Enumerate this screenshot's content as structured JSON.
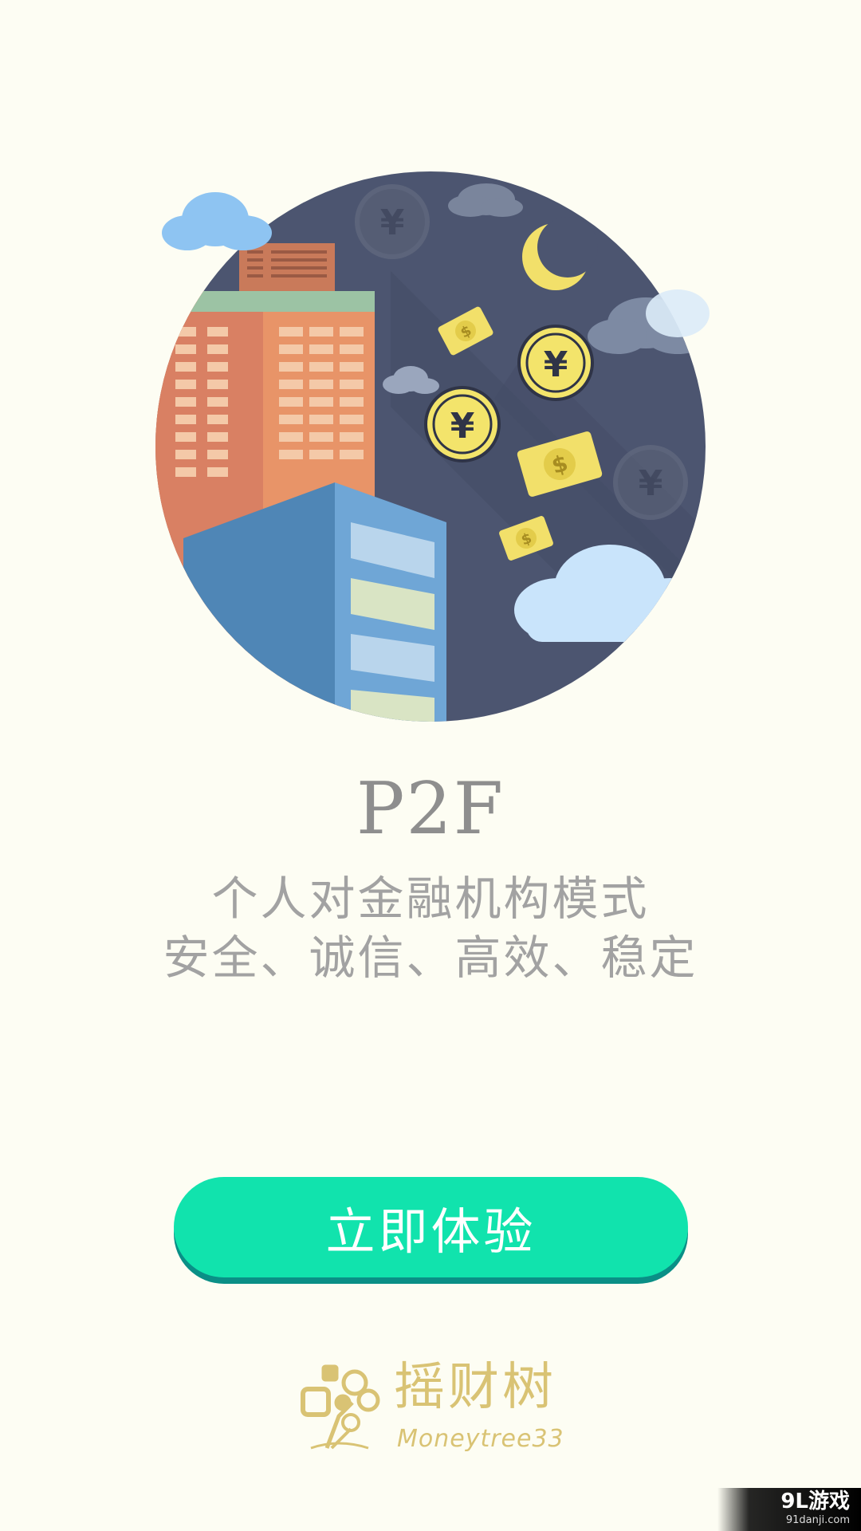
{
  "hero": {
    "illustration": "city-night-money-illustration",
    "currency_glyph": "¥",
    "bill_glyph": "$"
  },
  "headline": "P2F",
  "tagline": {
    "line1": "个人对金融机构模式",
    "line2": "安全、诚信、高效、稳定"
  },
  "cta": {
    "label": "立即体验"
  },
  "brand": {
    "name_cn": "摇财树",
    "name_en": "Moneytree33"
  },
  "watermark": {
    "main": "9L游戏",
    "sub": "91danji.com"
  },
  "colors": {
    "background": "#fdfdf3",
    "accent": "#11e3ad",
    "brand_gold": "#d9c374",
    "night_sky": "#4c5570"
  }
}
